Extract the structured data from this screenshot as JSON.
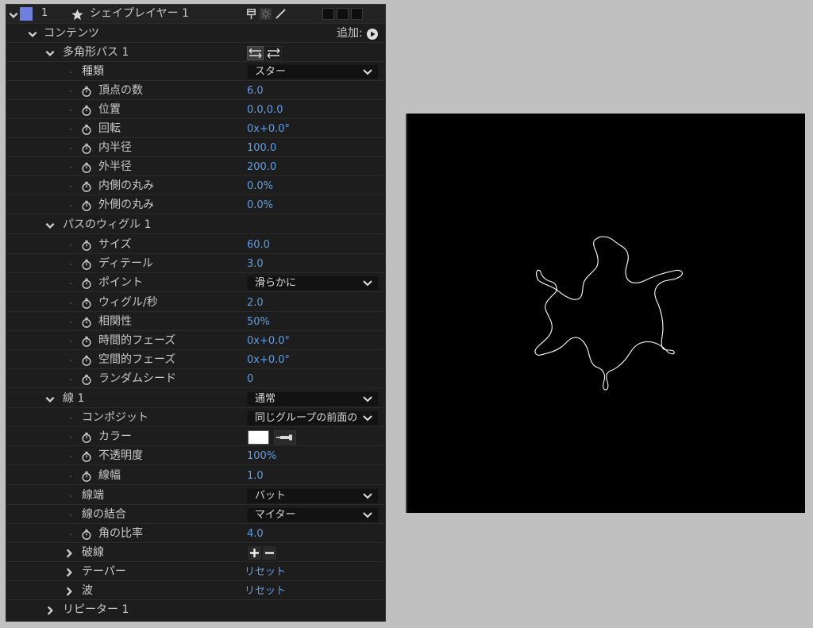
{
  "layer": {
    "index": "1",
    "name": "シェイプレイヤー 1",
    "label_color": "#6f7fe0"
  },
  "contents": {
    "label": "コンテンツ",
    "add_label": "追加:"
  },
  "polystar": {
    "label": "多角形パス 1",
    "type": {
      "label": "種類",
      "value": "スター"
    },
    "points": {
      "label": "頂点の数",
      "value": "6.0"
    },
    "position": {
      "label": "位置",
      "value": "0.0,0.0"
    },
    "rotation": {
      "label": "回転",
      "value": "0x+0.0°"
    },
    "inner_radius": {
      "label": "内半径",
      "value": "100.0"
    },
    "outer_radius": {
      "label": "外半径",
      "value": "200.0"
    },
    "inner_roundness": {
      "label": "内側の丸み",
      "value": "0.0%"
    },
    "outer_roundness": {
      "label": "外側の丸み",
      "value": "0.0%"
    }
  },
  "wiggle": {
    "label": "パスのウィグル 1",
    "size": {
      "label": "サイズ",
      "value": "60.0"
    },
    "detail": {
      "label": "ディテール",
      "value": "3.0"
    },
    "points": {
      "label": "ポイント",
      "value": "滑らかに"
    },
    "wiggles_per_sec": {
      "label": "ウィグル/秒",
      "value": "2.0"
    },
    "correlation": {
      "label": "相関性",
      "value": "50%"
    },
    "temporal_phase": {
      "label": "時間的フェーズ",
      "value": "0x+0.0°"
    },
    "spatial_phase": {
      "label": "空間的フェーズ",
      "value": "0x+0.0°"
    },
    "random_seed": {
      "label": "ランダムシード",
      "value": "0"
    }
  },
  "stroke": {
    "label": "線 1",
    "blend": "通常",
    "composite": {
      "label": "コンポジット",
      "value": "同じグループの前面の"
    },
    "color": {
      "label": "カラー",
      "value": "#ffffff"
    },
    "opacity": {
      "label": "不透明度",
      "value": "100%"
    },
    "width": {
      "label": "線幅",
      "value": "1.0"
    },
    "cap": {
      "label": "線端",
      "value": "バット"
    },
    "join": {
      "label": "線の結合",
      "value": "マイター"
    },
    "miter": {
      "label": "角の比率",
      "value": "4.0"
    },
    "dashes": {
      "label": "破線"
    },
    "taper": {
      "label": "テーパー",
      "link": "リセット"
    },
    "wave": {
      "label": "波",
      "link": "リセット"
    }
  },
  "repeater": {
    "label": "リピーター 1"
  }
}
